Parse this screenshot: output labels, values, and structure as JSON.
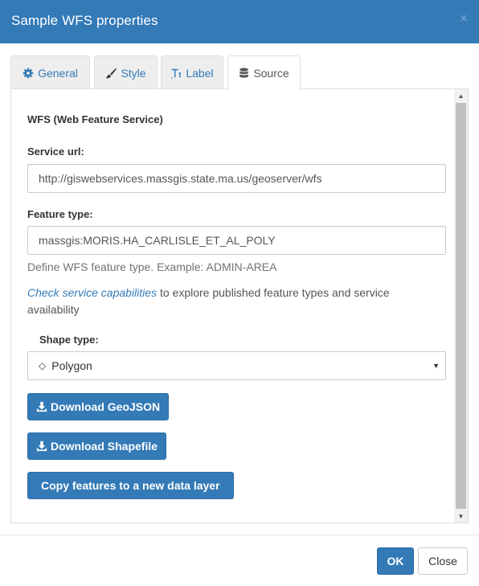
{
  "dialog": {
    "title": "Sample WFS properties",
    "close_glyph": "×"
  },
  "tabs": [
    {
      "label": "General",
      "icon": "gear-icon",
      "active": false
    },
    {
      "label": "Style",
      "icon": "brush-icon",
      "active": false
    },
    {
      "label": "Label",
      "icon": "text-icon",
      "active": false
    },
    {
      "label": "Source",
      "icon": "database-icon",
      "active": true
    }
  ],
  "source": {
    "section_title": "WFS (Web Feature Service)",
    "service_url_label": "Service url:",
    "service_url_value": "http://giswebservices.massgis.state.ma.us/geoserver/wfs",
    "feature_type_label": "Feature type:",
    "feature_type_value": "massgis:MORIS.HA_CARLISLE_ET_AL_POLY",
    "feature_type_help": "Define WFS feature type. Example: ADMIN-AREA",
    "capabilities_link": "Check service capabilities",
    "capabilities_text": " to explore published feature types and service availability",
    "shape_type_label": "Shape type:",
    "shape_type_value": "Polygon",
    "shape_type_icon": "◇",
    "download_geojson": "Download GeoJSON",
    "download_shapefile": "Download Shapefile",
    "copy_features": "Copy features to a new data layer"
  },
  "footer": {
    "ok_label": "OK",
    "close_label": "Close"
  },
  "colors": {
    "primary": "#337ab7",
    "header_bg": "#337ab7",
    "link": "#337ab7"
  }
}
